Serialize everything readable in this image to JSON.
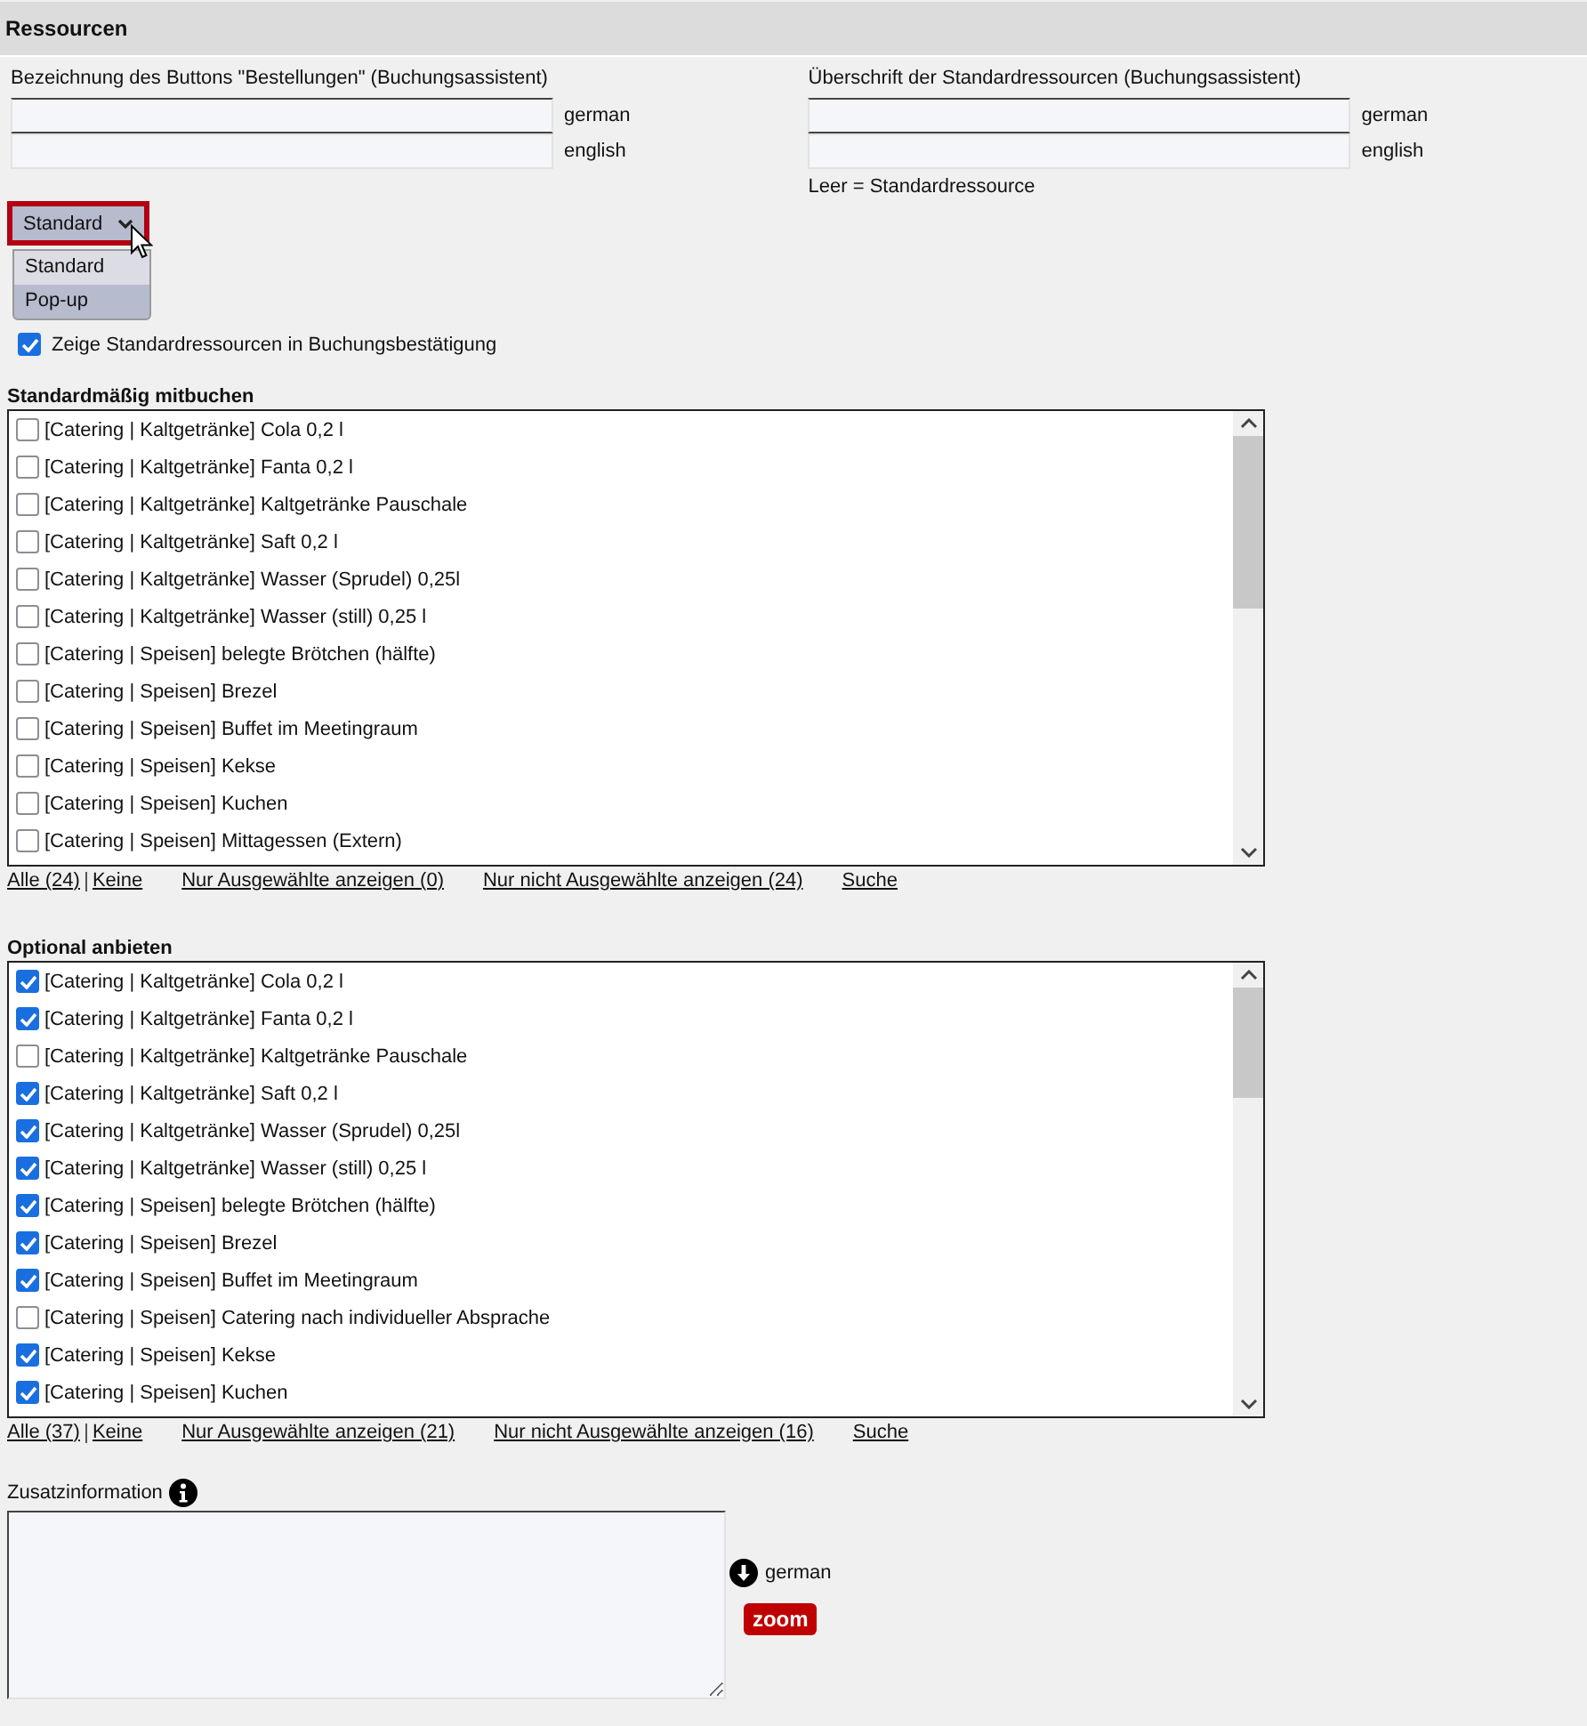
{
  "header": {
    "title": "Ressourcen"
  },
  "button_label": {
    "label": "Bezeichnung des Buttons \"Bestellungen\" (Buchungsassistent)",
    "fields": [
      {
        "lang": "german"
      },
      {
        "lang": "english"
      }
    ]
  },
  "default_heading": {
    "label": "Überschrift der Standardressourcen (Buchungsassistent)",
    "fields": [
      {
        "lang": "german"
      },
      {
        "lang": "english"
      }
    ],
    "hint": "Leer = Standardressource"
  },
  "display_select": {
    "value": "Standard",
    "expanded": true,
    "options": [
      {
        "label": "Standard",
        "selected": true
      },
      {
        "label": "Pop-up",
        "selected": false
      }
    ]
  },
  "show_default_resources": {
    "label": "Zeige Standardressourcen in Buchungsbestätigung",
    "checked": true
  },
  "lists": [
    {
      "title": "Standardmäßig mitbuchen",
      "items": [
        {
          "label": "[Catering | Kaltgetränke] Cola 0,2 l",
          "checked": false
        },
        {
          "label": "[Catering | Kaltgetränke] Fanta 0,2 l",
          "checked": false
        },
        {
          "label": "[Catering | Kaltgetränke] Kaltgetränke Pauschale",
          "checked": false
        },
        {
          "label": "[Catering | Kaltgetränke] Saft 0,2 l",
          "checked": false
        },
        {
          "label": "[Catering | Kaltgetränke] Wasser (Sprudel) 0,25l",
          "checked": false
        },
        {
          "label": "[Catering | Kaltgetränke] Wasser (still) 0,25 l",
          "checked": false
        },
        {
          "label": "[Catering | Speisen] belegte Brötchen (hälfte)",
          "checked": false
        },
        {
          "label": "[Catering | Speisen] Brezel",
          "checked": false
        },
        {
          "label": "[Catering | Speisen] Buffet im Meetingraum",
          "checked": false
        },
        {
          "label": "[Catering | Speisen] Kekse",
          "checked": false
        },
        {
          "label": "[Catering | Speisen] Kuchen",
          "checked": false
        },
        {
          "label": "[Catering | Speisen] Mittagessen (Extern)",
          "checked": false
        }
      ],
      "links": {
        "all": "Alle (24)",
        "none": "Keine",
        "selected": "Nur Ausgewählte anzeigen (0)",
        "unselected": "Nur nicht Ausgewählte anzeigen (24)",
        "search": "Suche"
      }
    },
    {
      "title": "Optional anbieten",
      "items": [
        {
          "label": "[Catering | Kaltgetränke] Cola 0,2 l",
          "checked": true
        },
        {
          "label": "[Catering | Kaltgetränke] Fanta 0,2 l",
          "checked": true
        },
        {
          "label": "[Catering | Kaltgetränke] Kaltgetränke Pauschale",
          "checked": false
        },
        {
          "label": "[Catering | Kaltgetränke] Saft 0,2 l",
          "checked": true
        },
        {
          "label": "[Catering | Kaltgetränke] Wasser (Sprudel) 0,25l",
          "checked": true
        },
        {
          "label": "[Catering | Kaltgetränke] Wasser (still) 0,25 l",
          "checked": true
        },
        {
          "label": "[Catering | Speisen] belegte Brötchen (hälfte)",
          "checked": true
        },
        {
          "label": "[Catering | Speisen] Brezel",
          "checked": true
        },
        {
          "label": "[Catering | Speisen] Buffet im Meetingraum",
          "checked": true
        },
        {
          "label": "[Catering | Speisen] Catering nach individueller Absprache",
          "checked": false
        },
        {
          "label": "[Catering | Speisen] Kekse",
          "checked": true
        },
        {
          "label": "[Catering | Speisen] Kuchen",
          "checked": true
        }
      ],
      "links": {
        "all": "Alle (37)",
        "none": "Keine",
        "selected": "Nur Ausgewählte anzeigen (21)",
        "unselected": "Nur nicht Ausgewählte anzeigen (16)",
        "search": "Suche"
      }
    }
  ],
  "additional_info": {
    "label": "Zusatzinformation",
    "lang": "german",
    "zoom_button": "zoom"
  }
}
